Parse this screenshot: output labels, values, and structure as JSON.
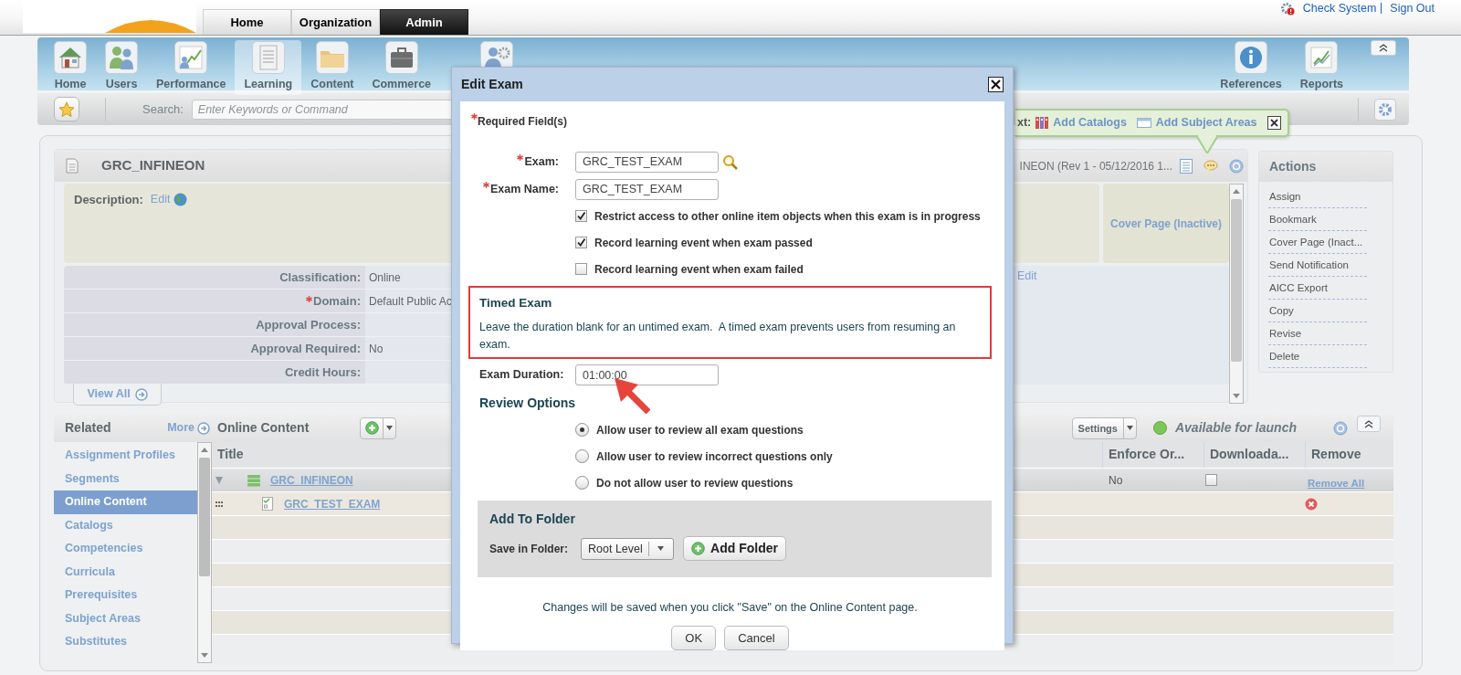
{
  "header": {
    "tabs": [
      {
        "label": "Home",
        "selected": false
      },
      {
        "label": "Organization",
        "selected": false
      },
      {
        "label": "Admin",
        "selected": true
      }
    ],
    "links": [
      "Check System",
      "Sign Out"
    ]
  },
  "toolbar": {
    "items": [
      {
        "label": "Home",
        "selected": false
      },
      {
        "label": "Users",
        "selected": false
      },
      {
        "label": "Performance",
        "selected": false
      },
      {
        "label": "Learning",
        "selected": true
      },
      {
        "label": "Content",
        "selected": false
      },
      {
        "label": "Commerce",
        "selected": false
      },
      {
        "selected": false
      }
    ],
    "right_items": [
      "References",
      "Reports"
    ]
  },
  "search": {
    "label": "Search:",
    "placeholder": "Enter Keywords or Command"
  },
  "context_tip": {
    "prefix": "xt:",
    "links": [
      "Add Catalogs",
      "Add Subject Areas"
    ]
  },
  "item": {
    "title": "GRC_INFINEON",
    "revision": "INEON (Rev 1 - 05/12/2016 1...",
    "description_label": "Description:",
    "description_edit": "Edit",
    "cover_page": "Cover Page (Inactive)",
    "fields": [
      {
        "label": "Classification:",
        "required": false,
        "value": "Online"
      },
      {
        "label": "Domain:",
        "required": true,
        "value": "Default Public Ac"
      },
      {
        "label": "Approval Process:",
        "required": false
      },
      {
        "label": "Approval Required:",
        "required": false,
        "value": "No"
      },
      {
        "label": "Credit Hours:",
        "required": false
      }
    ],
    "panel_edit": "Edit",
    "view_all": "View All"
  },
  "actions": {
    "title": "Actions",
    "items": [
      "Assign",
      "Bookmark",
      "Cover Page (Inact...",
      "Send Notification",
      "AICC Export",
      "Copy",
      "Revise",
      "Delete"
    ]
  },
  "related": {
    "title": "Related",
    "more": "More",
    "items": [
      {
        "label": "Assignment Profiles",
        "selected": false
      },
      {
        "label": "Segments",
        "selected": false
      },
      {
        "label": "Online Content",
        "selected": true
      },
      {
        "label": "Catalogs",
        "selected": false
      },
      {
        "label": "Competencies",
        "selected": false
      },
      {
        "label": "Curricula",
        "selected": false
      },
      {
        "label": "Prerequisites",
        "selected": false
      },
      {
        "label": "Subject Areas",
        "selected": false
      },
      {
        "label": "Substitutes",
        "selected": false
      }
    ]
  },
  "online_content": {
    "title": "Online Content",
    "settings": "Settings",
    "status": "Available for launch",
    "columns": [
      "Title",
      "Enforce Or...",
      "Downloada...",
      "Remove"
    ],
    "rows": [
      {
        "kind": "folder",
        "title": "GRC_INFINEON",
        "enforce_order": "No",
        "downloadable": false,
        "remove": "Remove All"
      },
      {
        "kind": "exam",
        "title": "GRC_TEST_EXAM"
      }
    ]
  },
  "dialog": {
    "title": "Edit Exam",
    "required_note": "Required Field(s)",
    "fields": [
      {
        "label": "Exam:",
        "required": true,
        "value": "GRC_TEST_EXAM",
        "lookup": true
      },
      {
        "label": "Exam Name:",
        "required": true,
        "value": "GRC_TEST_EXAM",
        "lookup": false
      }
    ],
    "options": [
      {
        "label": "Restrict access to other online item objects when this exam is in progress",
        "checked": true
      },
      {
        "label": "Record learning event when exam passed",
        "checked": true
      },
      {
        "label": "Record learning event when exam failed",
        "checked": false
      }
    ],
    "timed": {
      "title": "Timed Exam",
      "text": "Leave the duration blank for an untimed exam.  A timed exam prevents users from resuming an exam."
    },
    "duration": {
      "label": "Exam Duration:",
      "value": "01:00:00"
    },
    "review": {
      "title": "Review Options",
      "options": [
        {
          "label": "Allow user to review all exam questions",
          "selected": true
        },
        {
          "label": "Allow user to review incorrect questions only",
          "selected": false
        },
        {
          "label": "Do not allow user to review questions",
          "selected": false
        }
      ]
    },
    "folder": {
      "title": "Add To Folder",
      "label": "Save in Folder:",
      "value": "Root Level",
      "button": "Add Folder"
    },
    "note": "Changes will be saved when you click \"Save\" on the Online Content page.",
    "buttons": [
      "OK",
      "Cancel"
    ]
  }
}
